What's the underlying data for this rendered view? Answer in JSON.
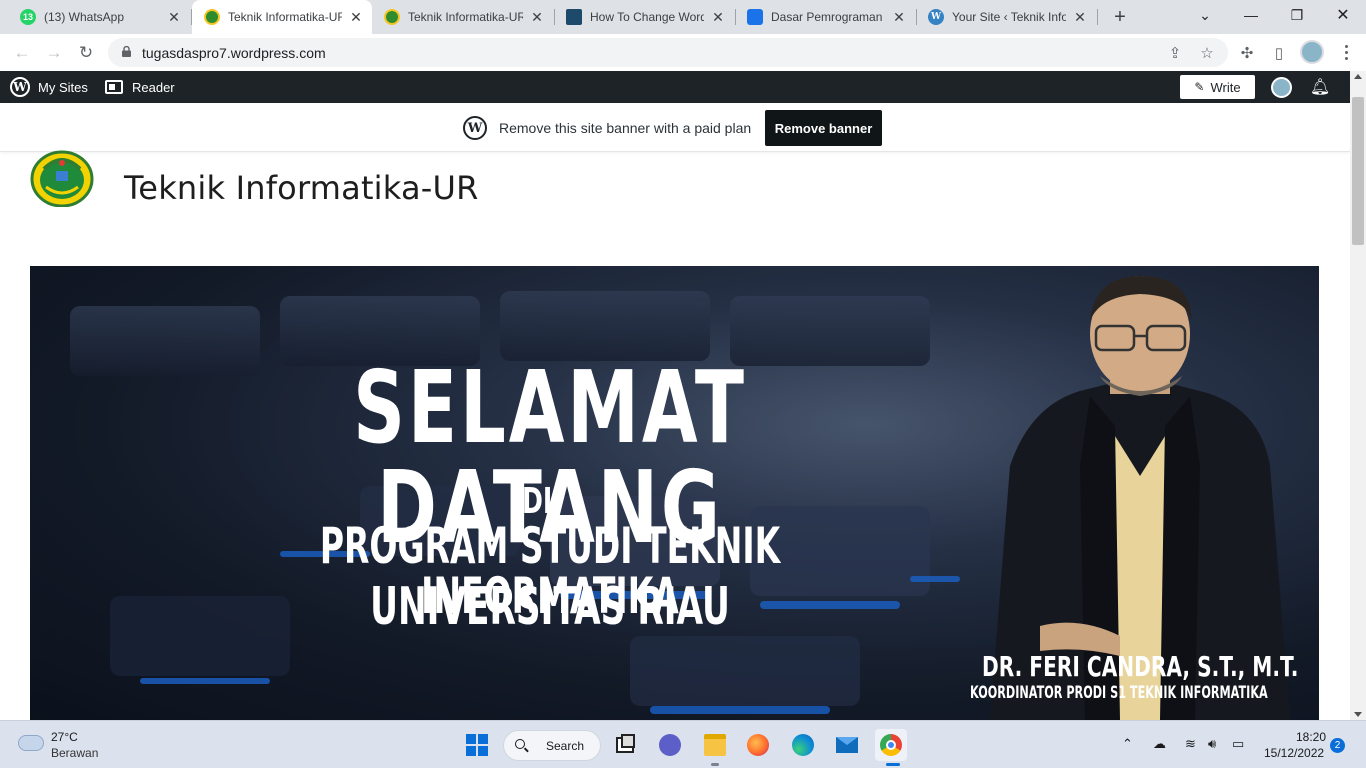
{
  "browser": {
    "tabs": [
      {
        "title": "(13) WhatsApp",
        "badge": "13",
        "favicon": "whatsapp-icon",
        "color": "#25d366"
      },
      {
        "title": "Teknik Informatika-UR",
        "favicon": "unri-logo-icon",
        "color": "#2e8b2e",
        "active": true
      },
      {
        "title": "Teknik Informatika-UR",
        "favicon": "unri-logo-icon",
        "color": "#2e8b2e"
      },
      {
        "title": "How To Change Word",
        "favicon": "site-favicon-icon",
        "color": "#1d4a6b"
      },
      {
        "title": "Dasar Pemrograman T",
        "favicon": "classroom-icon",
        "color": "#1a73e8"
      },
      {
        "title": "Your Site ‹ Teknik Infor",
        "favicon": "wordpress-icon",
        "color": "#3582c4"
      }
    ],
    "new_tab": "+",
    "url": "tugasdaspro7.wordpress.com"
  },
  "wp_admin_bar": {
    "my_sites": "My Sites",
    "reader": "Reader",
    "write": "Write"
  },
  "site_banner": {
    "text": "Remove this site banner with a paid plan",
    "button": "Remove banner"
  },
  "site": {
    "title": "Teknik Informatika-UR"
  },
  "hero": {
    "line1": "SELAMAT DATANG",
    "line2": "DI",
    "line3": "PROGRAM STUDI TEKNIK INFORMATIKA",
    "line4": "UNIVERSITAS RIAU",
    "person_name": "DR. FERI CANDRA, S.T., M.T.",
    "person_role": "KOORDINATOR PRODI S1 TEKNIK INFORMATIKA"
  },
  "taskbar": {
    "temperature": "27°C",
    "weather": "Berawan",
    "search": "Search",
    "time": "18:20",
    "date": "15/12/2022",
    "notifications": "2"
  },
  "colors": {
    "wp_bar": "#1d2327",
    "banner_button": "#101517",
    "taskbar": "#dbe2ee"
  }
}
